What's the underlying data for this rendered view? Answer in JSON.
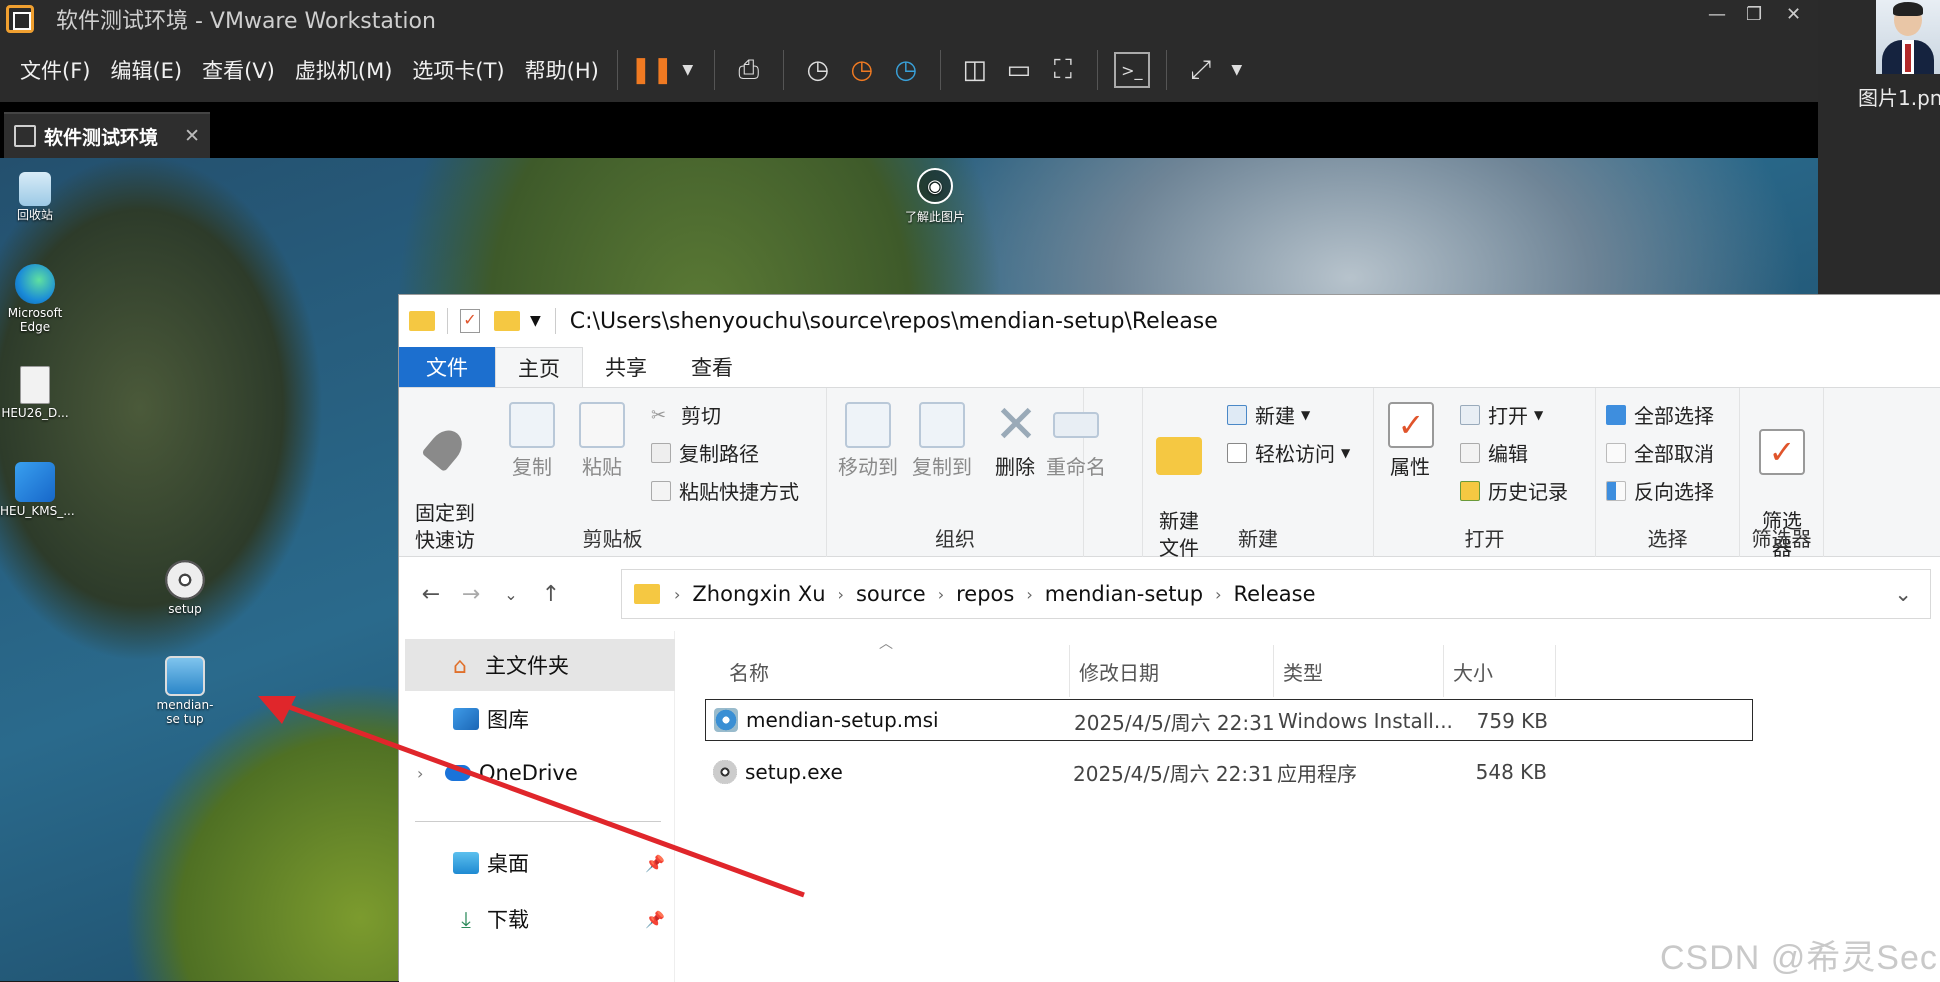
{
  "vmware": {
    "window_title": "软件测试环境 - VMware Workstation",
    "menu": [
      "文件(F)",
      "编辑(E)",
      "查看(V)",
      "虚拟机(M)",
      "选项卡(T)",
      "帮助(H)"
    ],
    "tab_label": "软件测试环境"
  },
  "host": {
    "file_label": "图片1.pn"
  },
  "desktop": {
    "learn_label": "了解此图片",
    "icons": [
      {
        "label": "回收站"
      },
      {
        "label": "Microsoft Edge"
      },
      {
        "label": "HEU26_D..."
      },
      {
        "label": "HEU_KMS_..."
      },
      {
        "label": "setup"
      },
      {
        "label": "mendian-se tup"
      }
    ]
  },
  "explorer": {
    "path": "C:\\Users\\shenyouchu\\source\\repos\\mendian-setup\\Release",
    "ribbon_tabs": [
      "文件",
      "主页",
      "共享",
      "查看"
    ],
    "clipboard": {
      "pin": "固定到\n快速访问",
      "copy": "复制",
      "paste": "粘贴",
      "cut": "剪切",
      "copy_path": "复制路径",
      "paste_shortcut": "粘贴快捷方式",
      "label": "剪贴板"
    },
    "organize": {
      "move_to": "移动到",
      "copy_to": "复制到",
      "delete": "删除",
      "rename": "重命名",
      "label": "组织"
    },
    "new_group": {
      "new_folder": "新建\n文件夹",
      "new_item": "新建",
      "easy_access": "轻松访问",
      "label": "新建"
    },
    "open_group": {
      "properties": "属性",
      "open": "打开",
      "edit": "编辑",
      "history": "历史记录",
      "label": "打开"
    },
    "select_group": {
      "select_all": "全部选择",
      "select_none": "全部取消",
      "invert": "反向选择",
      "label": "选择"
    },
    "filter_group": {
      "filter": "筛选\n器",
      "label": "筛选器"
    },
    "breadcrumb": [
      "Zhongxin Xu",
      "source",
      "repos",
      "mendian-setup",
      "Release"
    ],
    "nav_pane": [
      {
        "label": "主文件夹"
      },
      {
        "label": "图库"
      },
      {
        "label": "OneDrive"
      },
      {
        "label": "桌面"
      },
      {
        "label": "下载"
      }
    ],
    "columns": [
      "名称",
      "修改日期",
      "类型",
      "大小"
    ],
    "files": [
      {
        "name": "mendian-setup.msi",
        "date": "2025/4/5/周六 22:31",
        "type": "Windows Install...",
        "size": "759 KB"
      },
      {
        "name": "setup.exe",
        "date": "2025/4/5/周六 22:31",
        "type": "应用程序",
        "size": "548 KB"
      }
    ]
  },
  "watermark": "CSDN @希灵Sec",
  "colors": {
    "accent": "#1c6fcf",
    "annotation_arrow": "#e0262b",
    "vmware_orange": "#f07a22"
  }
}
